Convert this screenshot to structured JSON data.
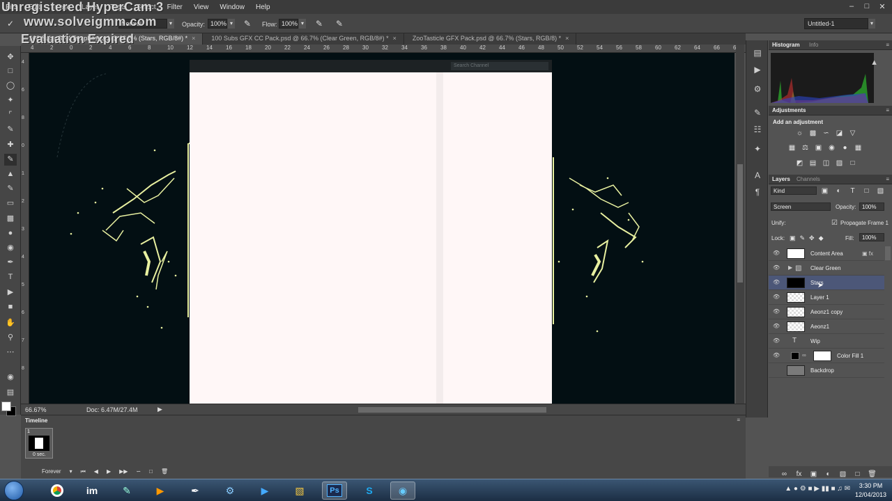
{
  "watermark": {
    "line1": "Unregistered HyperCam 3",
    "line2": "www.solveigmm.com",
    "line3": "Evaluation Expired"
  },
  "menubar": {
    "items": [
      "File",
      "Edit",
      "Image",
      "Layer",
      "Type",
      "Select",
      "Filter",
      "View",
      "Window",
      "Help"
    ]
  },
  "options": {
    "mode_value": "Normal",
    "opacity_label": "Opacity:",
    "opacity_value": "100%",
    "flow_label": "Flow:",
    "flow_value": "100%",
    "workspace": "Untitled-1"
  },
  "doc_tabs": [
    {
      "label": "100 Subs GFX Template.psd @ 66.7% (Stars, RGB/8#) *",
      "active": true
    },
    {
      "label": "100 Subs GFX CC Pack.psd @ 66.7% (Clear Green, RGB/8#) *",
      "active": false
    },
    {
      "label": "ZooTasticle GFX Pack.psd @ 66.7% (Stars, RGB/8) *",
      "active": false
    }
  ],
  "ruler_top": [
    "4",
    "2",
    "0",
    "2",
    "4",
    "6",
    "8",
    "10",
    "12",
    "14",
    "16",
    "18",
    "20",
    "22",
    "24",
    "26",
    "28",
    "30",
    "32",
    "34",
    "36",
    "38",
    "40",
    "42",
    "44",
    "46",
    "48",
    "50",
    "52",
    "54",
    "56",
    "58",
    "60",
    "62",
    "64",
    "66",
    "68"
  ],
  "ruler_left": [
    "4",
    "6",
    "8",
    "0",
    "1",
    "2",
    "3",
    "4",
    "5",
    "6",
    "7",
    "8"
  ],
  "canvas": {
    "search_placeholder": "Search Channel",
    "background": "#030f13",
    "sheet_color": "#fff7f7",
    "sparkle_color": "#e8f0a0"
  },
  "status": {
    "zoom": "66.67%",
    "doc": "Doc: 6.47M/27.4M"
  },
  "histogram": {
    "tab": "Histogram",
    "tab2": "Info"
  },
  "adjustments": {
    "tab": "Adjustments",
    "title": "Add an adjustment"
  },
  "layers": {
    "tab": "Layers",
    "tab2": "Channels",
    "kind": "Kind",
    "blend": "Screen",
    "opacity_label": "Opacity:",
    "opacity_value": "100%",
    "unify_label": "Unify:",
    "propagate": "Propagate Frame 1",
    "lock_label": "Lock:",
    "fill_label": "Fill:",
    "fill_value": "100%",
    "items": [
      {
        "name": "Content Area",
        "type": "layer",
        "selected": false
      },
      {
        "name": "Clear Green",
        "type": "group",
        "selected": false
      },
      {
        "name": "Stars",
        "type": "layer",
        "selected": true
      },
      {
        "name": "Layer 1",
        "type": "layer",
        "selected": false
      },
      {
        "name": "Aeonz1 copy",
        "type": "layer",
        "selected": false
      },
      {
        "name": "Aeonz1",
        "type": "layer",
        "selected": false
      },
      {
        "name": "Wip",
        "type": "text",
        "selected": false
      },
      {
        "name": "Color Fill 1",
        "type": "fill",
        "selected": false
      },
      {
        "name": "Backdrop",
        "type": "layer",
        "selected": false
      }
    ]
  },
  "timeline": {
    "title": "Timeline",
    "frame_num": "1",
    "frame_dur": "0 sec.",
    "loop": "Forever"
  },
  "taskbar": {
    "apps": [
      "chrome",
      "im",
      "vector",
      "media",
      "pen",
      "settings",
      "play",
      "folder",
      "Ps",
      "skype",
      "browser"
    ],
    "time": "3:30 PM",
    "date": "12/04/2013"
  }
}
